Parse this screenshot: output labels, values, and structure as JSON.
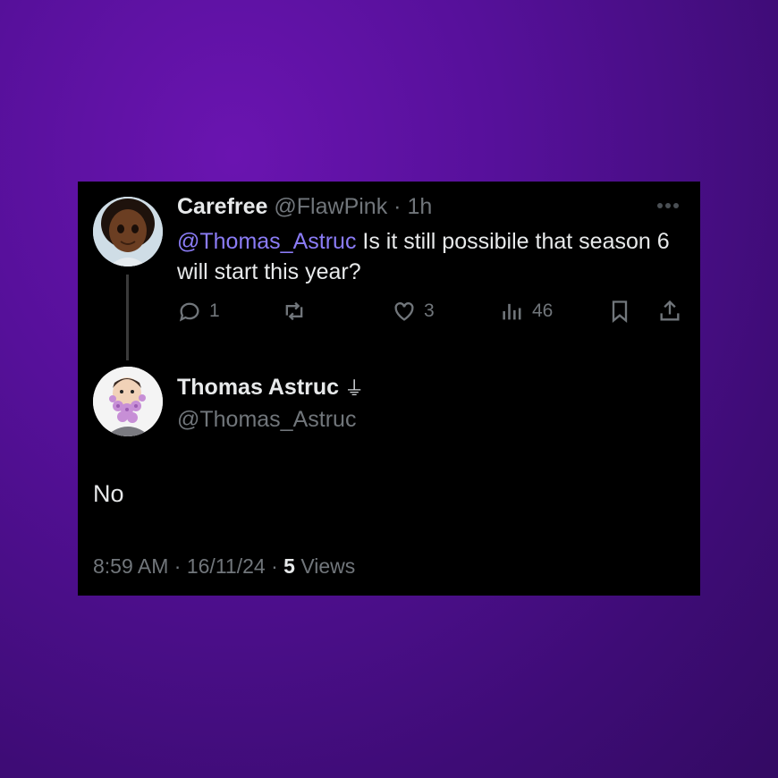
{
  "tweet": {
    "author_name": "Carefree",
    "author_handle": "@FlawPink",
    "separator": "·",
    "time_ago": "1h",
    "mention": "@Thomas_Astruc",
    "text": " Is it still possibile that season 6 will start this year?",
    "actions": {
      "reply_count": "1",
      "retweet_count": "",
      "like_count": "3",
      "views_count": "46"
    }
  },
  "reply": {
    "author_name": "Thomas Astruc",
    "author_badge": "⏚",
    "author_handle": "@Thomas_Astruc",
    "text": "No",
    "time": "8:59 AM",
    "date": "16/11/24",
    "views_count": "5",
    "views_label": "Views",
    "separator": "·"
  },
  "icons": [
    "more-icon",
    "reply-icon",
    "retweet-icon",
    "like-icon",
    "views-icon",
    "bookmark-icon",
    "share-icon"
  ],
  "colors": {
    "background": "#56109a",
    "card": "#000000",
    "mention": "#8b7cf6",
    "muted": "#71767b",
    "text": "#e7e9ea"
  }
}
